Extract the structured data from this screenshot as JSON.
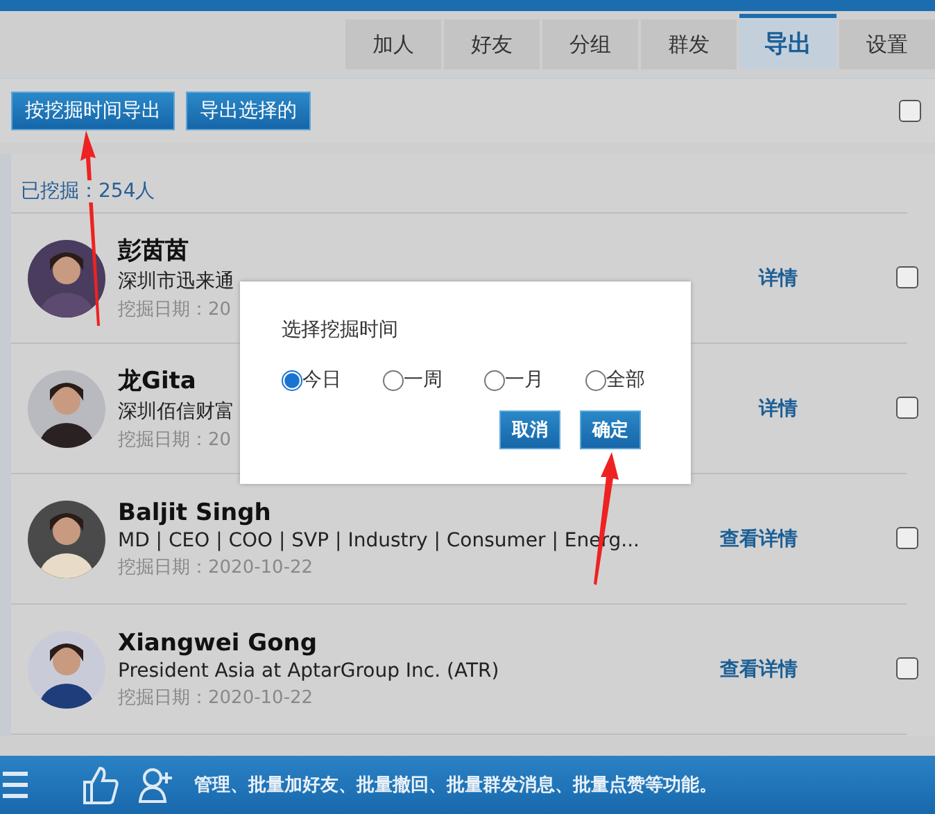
{
  "tabs": [
    {
      "label": "加人",
      "selected": false
    },
    {
      "label": "好友",
      "selected": false
    },
    {
      "label": "分组",
      "selected": false
    },
    {
      "label": "群发",
      "selected": false
    },
    {
      "label": "导出",
      "selected": true
    },
    {
      "label": "设置",
      "selected": false
    }
  ],
  "toolbar": {
    "buttons": [
      "按挖掘时间导出",
      "导出选择的"
    ],
    "select_all_checked": false
  },
  "count": "已挖掘：254人",
  "contacts": [
    {
      "name": "彭茵茵",
      "headline": "深圳市迅来通",
      "date": "挖掘日期：20",
      "link": "详情",
      "checked": false
    },
    {
      "name": "龙Gita",
      "headline": "深圳佰信财富",
      "date": "挖掘日期：20",
      "link": "详情",
      "checked": false
    },
    {
      "name": "Baljit Singh",
      "headline": "MD | CEO | COO | SVP | Industry | Consumer | Energ...",
      "date": "挖掘日期：2020-10-22",
      "link": "查看详情",
      "checked": false
    },
    {
      "name": "Xiangwei Gong",
      "headline": "President Asia at AptarGroup Inc. (ATR)",
      "date": "挖掘日期：2020-10-22",
      "link": "查看详情",
      "checked": false
    }
  ],
  "dialog": {
    "title": "选择挖掘时间",
    "options": [
      {
        "label": "今日",
        "selected": true
      },
      {
        "label": "一周",
        "selected": false
      },
      {
        "label": "一月",
        "selected": false
      },
      {
        "label": "全部",
        "selected": false
      }
    ],
    "buttons": [
      "取消",
      "确定"
    ]
  },
  "bottom_bar": {
    "text": "管理、批量加好友、批量撤回、批量群发消息、批量点赞等功能。"
  }
}
